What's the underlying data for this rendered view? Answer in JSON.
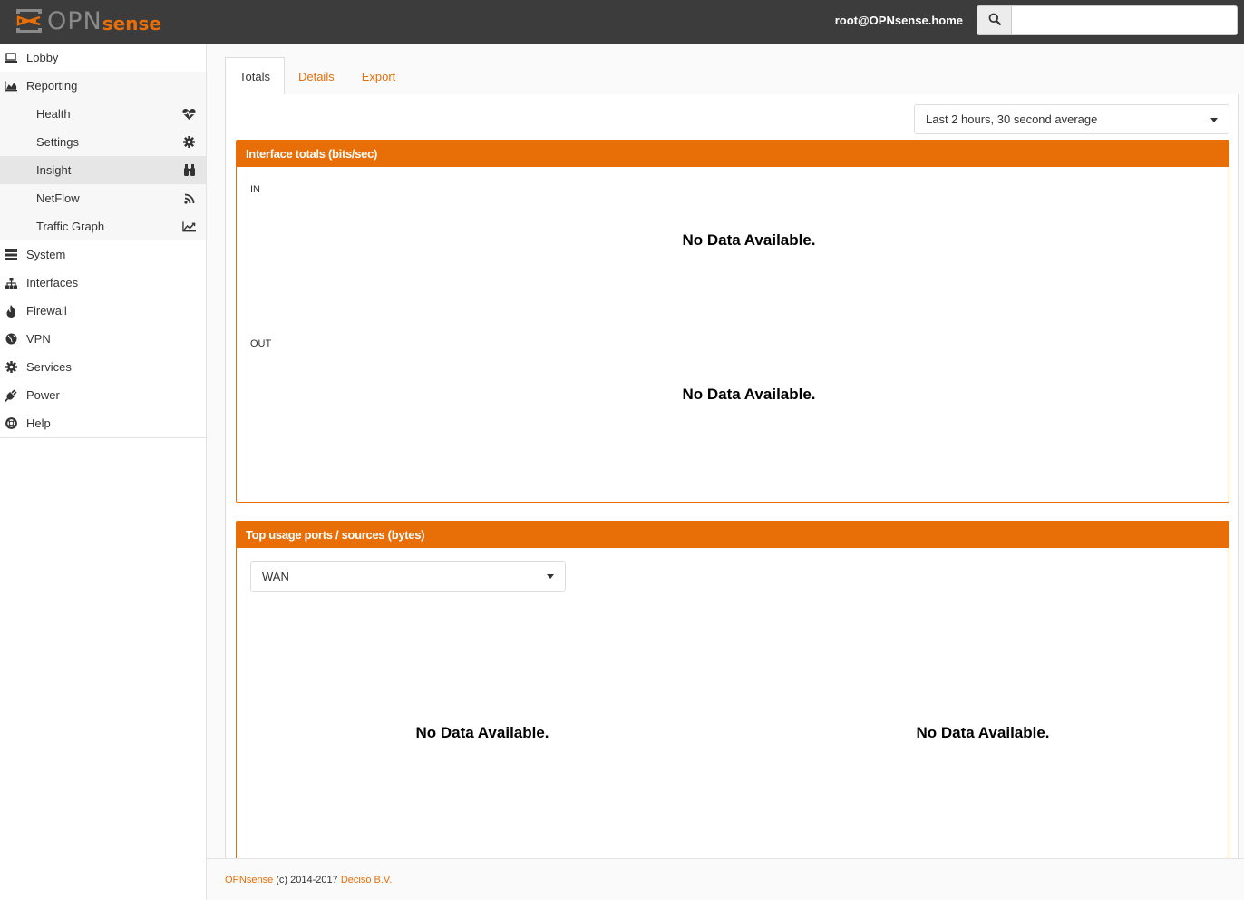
{
  "topbar": {
    "logo_main": "OPN",
    "logo_sub": "sense",
    "user": "root@OPNsense.home",
    "search_value": "",
    "icons": {
      "search": "search-icon"
    }
  },
  "colors": {
    "accent": "#e86e08",
    "topbar": "#3c3c3c"
  },
  "sidebar": {
    "items": [
      {
        "label": "Lobby",
        "icon": "laptop-icon"
      },
      {
        "label": "Reporting",
        "icon": "area-chart-icon"
      },
      {
        "label": "System",
        "icon": "server-icon"
      },
      {
        "label": "Interfaces",
        "icon": "sitemap-icon"
      },
      {
        "label": "Firewall",
        "icon": "fire-icon"
      },
      {
        "label": "VPN",
        "icon": "globe-icon"
      },
      {
        "label": "Services",
        "icon": "cog-icon"
      },
      {
        "label": "Power",
        "icon": "plug-icon"
      },
      {
        "label": "Help",
        "icon": "life-ring-icon"
      }
    ],
    "reporting_children": [
      {
        "label": "Health",
        "icon": "heartbeat-icon"
      },
      {
        "label": "Settings",
        "icon": "cog-icon"
      },
      {
        "label": "Insight",
        "icon": "binoculars-icon",
        "active": true
      },
      {
        "label": "NetFlow",
        "icon": "rss-icon"
      },
      {
        "label": "Traffic Graph",
        "icon": "line-chart-icon"
      }
    ]
  },
  "main": {
    "tabs": [
      {
        "label": "Totals",
        "active": true
      },
      {
        "label": "Details"
      },
      {
        "label": "Export"
      }
    ],
    "timeframe_select": "Last 2 hours, 30 second average",
    "interface_panel": {
      "title": "Interface totals (bits/sec)",
      "in_label": "IN",
      "out_label": "OUT",
      "in_nodata": "No Data Available.",
      "out_nodata": "No Data Available."
    },
    "top_panel": {
      "title": "Top usage ports / sources (bytes)",
      "interface_select": "WAN",
      "left_nodata": "No Data Available.",
      "right_nodata": "No Data Available."
    }
  },
  "footer": {
    "brand": "OPNsense",
    "copyright": " (c) 2014-2017 ",
    "company": "Deciso B.V."
  }
}
